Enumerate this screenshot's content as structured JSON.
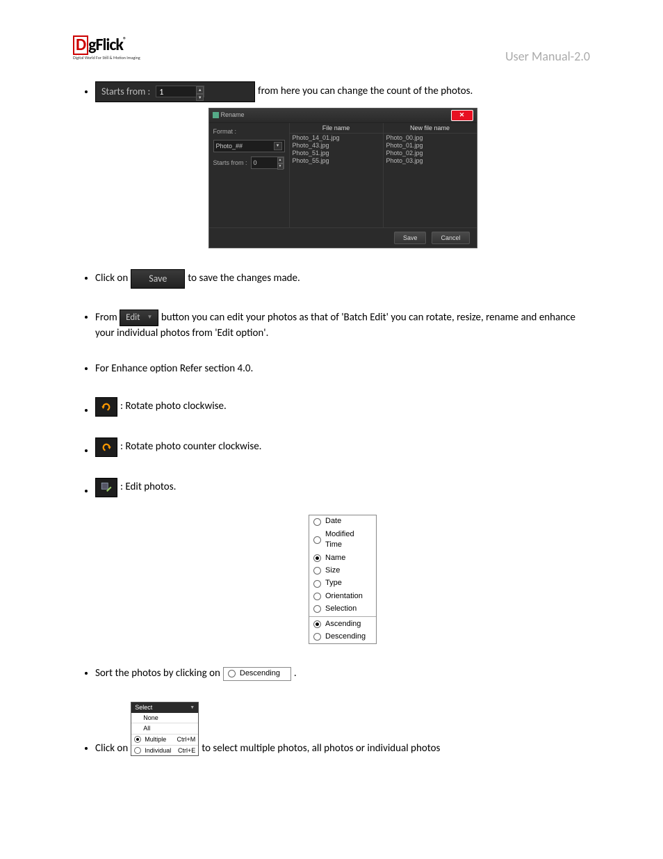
{
  "header": {
    "logo_d": "D",
    "logo_rest": "gFlick",
    "logo_reg": "®",
    "logo_sub": "Digital World For Still & Motion Imaging",
    "right": "User Manual-2.0"
  },
  "bullets": {
    "b1": {
      "chip_label": "Starts from :",
      "chip_value": "1",
      "text_after": " from here you can change the count of the photos."
    },
    "rename": {
      "title": "Rename",
      "format_label": "Format :",
      "format_value": "Photo_##",
      "starts_label": "Starts from :",
      "starts_value": "0",
      "col1_head": "File name",
      "col2_head": "New file name",
      "col1_rows": [
        "Photo_14_01.jpg",
        "Photo_43.jpg",
        "Photo_51.jpg",
        "Photo_55.jpg"
      ],
      "col2_rows": [
        "Photo_00.jpg",
        "Photo_01.jpg",
        "Photo_02.jpg",
        "Photo_03.jpg"
      ],
      "save_btn": "Save",
      "cancel_btn": "Cancel"
    },
    "b2": {
      "pre": "Click on ",
      "save_chip": "Save",
      "post": " to  save the changes made."
    },
    "b3": {
      "pre": "From ",
      "edit_chip": "Edit",
      "post1": " button you can edit your photos as that of 'Batch Edit' you can rotate, resize, rename and enhance your individual photos from 'Edit option'."
    },
    "b4": "For Enhance option Refer section 4.0.",
    "b5": ": Rotate photo clockwise.",
    "b6": ": Rotate photo counter clockwise.",
    "b7": ": Edit photos.",
    "sort_menu": {
      "items": [
        "Date",
        "Modified Time",
        "Name",
        "Size",
        "Type",
        "Orientation",
        "Selection"
      ],
      "selected": "Name",
      "order": [
        "Ascending",
        "Descending"
      ],
      "order_selected": "Ascending"
    },
    "b8": {
      "pre": "Sort the photos by clicking on",
      "post": "."
    },
    "select_menu": {
      "header": "Select",
      "rows": [
        {
          "label": "None",
          "shortcut": "",
          "radio": false
        },
        {
          "label": "All",
          "shortcut": "",
          "radio": false
        },
        {
          "label": "Multiple",
          "shortcut": "Ctrl+M",
          "radio": true,
          "checked": true
        },
        {
          "label": "Individual",
          "shortcut": "Ctrl+E",
          "radio": true,
          "checked": false
        }
      ]
    },
    "b9": {
      "pre": "Click on ",
      "post": " to select multiple photos, all photos or individual photos"
    }
  }
}
